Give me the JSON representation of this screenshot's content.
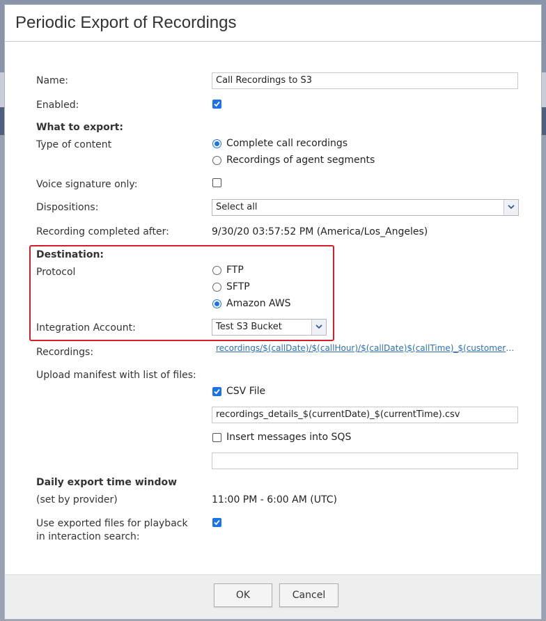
{
  "dialog": {
    "title": "Periodic Export of Recordings"
  },
  "fields": {
    "name_label": "Name:",
    "name_value": "Call Recordings to S3",
    "enabled_label": "Enabled:",
    "enabled_checked": true,
    "what_to_export": "What to export:",
    "type_of_content_label": "Type of content",
    "content_options": [
      "Complete call recordings",
      "Recordings of agent segments"
    ],
    "content_selected": "Complete call recordings",
    "voice_signature_label": "Voice signature only:",
    "voice_signature_checked": false,
    "dispositions_label": "Dispositions:",
    "dispositions_value": "Select all",
    "recording_completed_label": "Recording completed after:",
    "recording_completed_value": "9/30/20 03:57:52 PM (America/Los_Angeles)"
  },
  "destination": {
    "heading": "Destination:",
    "protocol_label": "Protocol",
    "protocol_options": [
      "FTP",
      "SFTP",
      "Amazon AWS"
    ],
    "protocol_selected": "Amazon AWS",
    "integration_label": "Integration Account:",
    "integration_value": "Test S3 Bucket"
  },
  "recordings": {
    "label": "Recordings:",
    "path": "recordings/$(callDate)/$(callHour)/$(callDate)$(callTime)_$(customerPhone)_$(agentName).wav"
  },
  "manifest": {
    "label": "Upload manifest with list of files:",
    "csv_label": "CSV File",
    "csv_checked": true,
    "csv_filename": "recordings_details_$(currentDate)_$(currentTime).csv",
    "sqs_label": "Insert messages into SQS",
    "sqs_checked": false,
    "sqs_value": ""
  },
  "window": {
    "heading": "Daily export time window",
    "sub_label": "(set by provider)",
    "value": "11:00 PM - 6:00 AM (UTC)"
  },
  "playback": {
    "label_line1": "Use exported files for playback",
    "label_line2": "in interaction search:",
    "checked": true
  },
  "buttons": {
    "ok": "OK",
    "cancel": "Cancel"
  },
  "colors": {
    "accent": "#1a73e8",
    "highlight_border": "#d21f26",
    "link": "#2d6fb3"
  }
}
